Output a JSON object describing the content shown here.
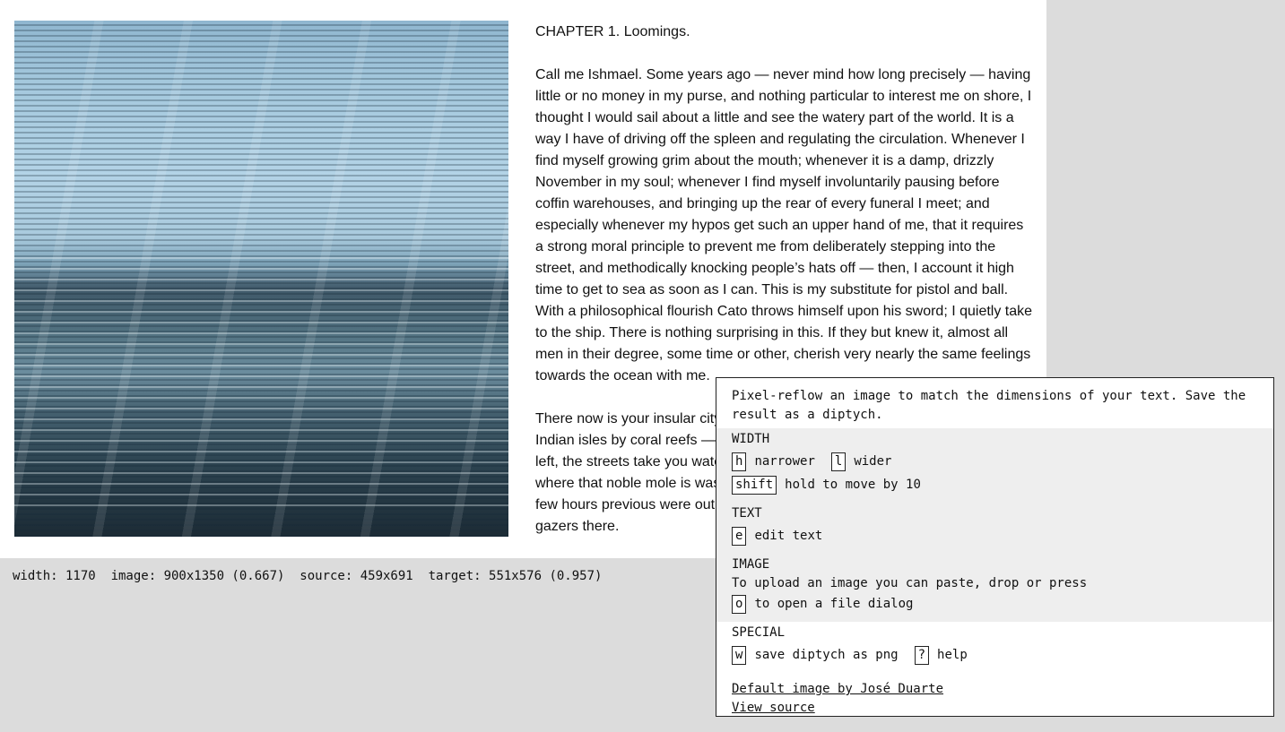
{
  "chapter": {
    "heading": "CHAPTER 1. Loomings.",
    "paragraphs": [
      "Call me Ishmael. Some years ago — never mind how long precisely — having little or no money in my purse, and nothing particular to interest me on shore, I thought I would sail about a little and see the watery part of the world. It is a way I have of driving off the spleen and regulating the circulation. Whenever I find myself growing grim about the mouth; whenever it is a damp, drizzly November in my soul; whenever I find myself involuntarily pausing before coffin warehouses, and bringing up the rear of every funeral I meet; and especially whenever my hypos get such an upper hand of me, that it requires a strong moral principle to prevent me from deliberately stepping into the street, and methodically knocking people’s hats off — then, I account it high time to get to sea as soon as I can. This is my substitute for pistol and ball.  With a philosophical flourish Cato throws himself upon his sword; I quietly take to the ship. There is nothing surprising in this. If they but knew it, almost all men in their degree, some time or other, cherish very nearly the same feelings towards the ocean with me.",
      "There now is your insular city of the Manhattoes, belted round by wharves as Indian isles by coral reefs — commerce surrounds it with her surf. Right and left, the streets take you waterward. Its extreme downtown is the battery, where that noble mole is washed by waves, and cooled by breezes, which a few hours previous were out of sight of land. Look at the crowds of water-gazers there."
    ]
  },
  "status": {
    "line": "width: 1170  image: 900x1350 (0.667)  source: 459x691  target: 551x576 (0.957)"
  },
  "help": {
    "intro": "Pixel-reflow an image to match the dimensions of your text. Save the result as a diptych.",
    "width": {
      "heading": "WIDTH",
      "narrower_key": "h",
      "narrower_label": "narrower",
      "wider_key": "l",
      "wider_label": "wider",
      "shift_key": "shift",
      "shift_label": "hold to move by 10"
    },
    "text": {
      "heading": "TEXT",
      "edit_key": "e",
      "edit_label": "edit text"
    },
    "image": {
      "heading": "IMAGE",
      "upload_line": "To upload an image you can paste, drop or press",
      "open_key": "o",
      "open_label": "to open a file dialog"
    },
    "special": {
      "heading": "SPECIAL",
      "save_key": "w",
      "save_label": "save diptych as png",
      "help_key": "?",
      "help_label": "help"
    },
    "links": {
      "credit": "Default image by José Duarte",
      "source": "View source"
    }
  }
}
